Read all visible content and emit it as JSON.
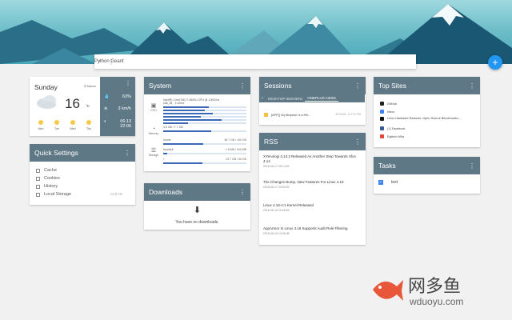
{
  "search": {
    "value": "Python Geant"
  },
  "fab": {
    "label": "+"
  },
  "weather": {
    "day": "Sunday",
    "location": "Norco",
    "temp": "16",
    "unit": "°C",
    "forecast": [
      "Mon",
      "Tue",
      "Wed",
      "Thu"
    ],
    "humidity": "63%",
    "wind": "3 km/h",
    "sunrise": "06:13",
    "sunset": "22:05"
  },
  "system": {
    "title": "System",
    "cpu_label": "CPU",
    "memory_label": "Memory",
    "storage_label": "Storage",
    "cpu_name": "Intel(R) Core(TM) i7-4500U CPU @ 1.80GHz",
    "cpu_arch": "x86_64 · 4 cores",
    "cpu_usage": [
      0.55,
      0.5,
      0.6,
      0.45,
      0.7,
      0.3
    ],
    "memory_text": "4.5 GB / 7.7 GB",
    "memory_usage": 0.58,
    "storage": [
      {
        "name": "/home",
        "size": "48.7 GB / 100 GB",
        "usage": 0.48
      },
      {
        "name": "/boot/efi",
        "size": "1.8 MB / 300 MB",
        "usage": 0.05
      },
      {
        "name": "/",
        "size": "23.7 GB / 50 GB",
        "usage": 0.47
      }
    ]
  },
  "quick_settings": {
    "title": "Quick Settings",
    "items": [
      "Cache",
      "Cookies",
      "History",
      "Local Storage"
    ],
    "clear": "CLEAR"
  },
  "downloads": {
    "title": "Downloads",
    "empty": "You have no downloads."
  },
  "sessions": {
    "title": "Sessions",
    "tabs": [
      "DESKTOP-6E5V9RG",
      "ONEPLUS A3003"
    ],
    "entry": "[APP][ 0x] Mlxplore nl a Rel...",
    "entry_time": "4/7/2018, 1:17:21 PM"
  },
  "rss": {
    "title": "RSS",
    "items": [
      {
        "title": "XYenologi 4.13.2 Released As Another Step Towards Xfce 4.14",
        "date": "2018-06-17 09:14:49"
      },
      {
        "title": "The Changes Bump, New Features For Linux 4.19",
        "date": "2018-06-17 03:54:09"
      },
      {
        "title": "Linux 4.18-rc1 Kernel Released",
        "date": "2018-06-16 23:26:45"
      },
      {
        "title": "AppArmor In Linux 4.18 Supports Audit Rule Filtering",
        "date": "2018-06-16 13:05:38"
      }
    ]
  },
  "top_sites": {
    "title": "Top Sites",
    "items": [
      {
        "label": "GitHub",
        "color": "#222222"
      },
      {
        "label": "Inbox",
        "color": "#3b82f6"
      },
      {
        "label": "Linux Hardware Reviews, Open-Source Benchmarks ...",
        "color": "#111111"
      },
      {
        "label": "(1) Facebook",
        "color": "#3b5998"
      },
      {
        "label": "Egitech Mira",
        "color": "#e0463a"
      }
    ]
  },
  "tasks": {
    "title": "Tasks",
    "items": [
      "test"
    ]
  },
  "watermark": {
    "chinese": "网多鱼",
    "url": "wduoyu.com"
  }
}
